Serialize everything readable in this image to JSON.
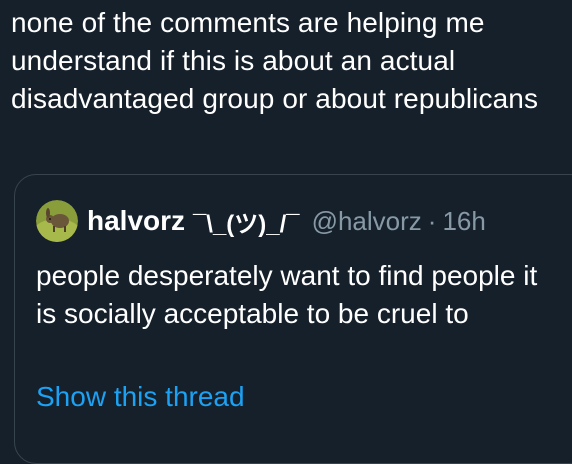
{
  "tweet": {
    "text": "none of the comments are helping me understand if this is about an actual disadvantaged group or about republicans"
  },
  "quote": {
    "display_name": "halvorz",
    "name_suffix": "¯\\_(ツ)_/¯",
    "handle": "@halvorz",
    "separator": "·",
    "time": "16h",
    "text": "people desperately want to find people it is socially acceptable to be cruel to",
    "show_thread_label": "Show this thread",
    "colors": {
      "background": "#15202b",
      "border": "#38444d",
      "secondary_text": "#8899a6",
      "link": "#1da1f2"
    },
    "avatar_icon": "animal-photo-avatar"
  }
}
